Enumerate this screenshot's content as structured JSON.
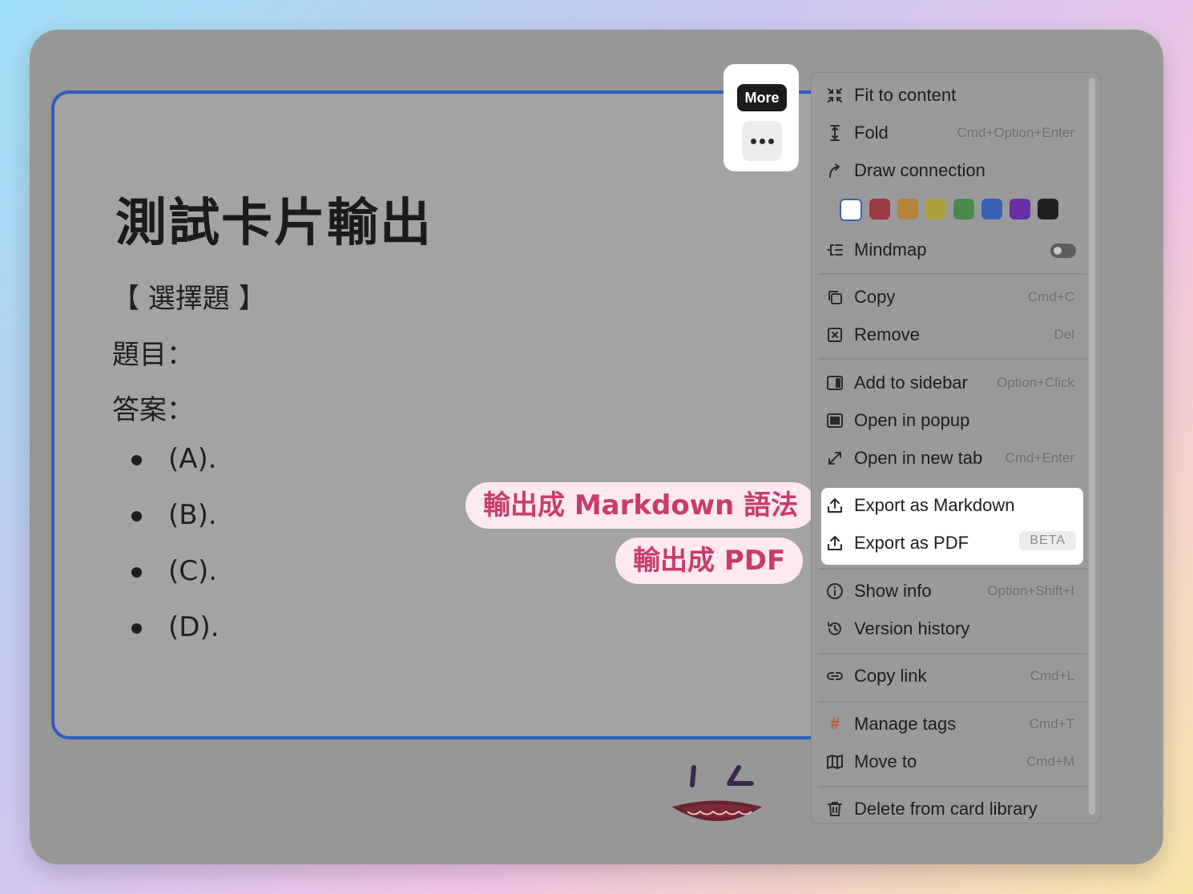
{
  "card": {
    "title": "測試卡片輸出",
    "section": "【 選擇題 】",
    "question_label": "題目：",
    "answer_label": "答案：",
    "options": [
      "(A).",
      "(B).",
      "(C).",
      "(D)."
    ]
  },
  "more": {
    "tooltip": "More"
  },
  "callouts": {
    "markdown": "輸出成 Markdown 語法",
    "pdf": "輸出成 PDF"
  },
  "menu": {
    "fit": {
      "label": "Fit to content",
      "icon": "fit-icon"
    },
    "fold": {
      "label": "Fold",
      "shortcut": "Cmd+Option+Enter",
      "icon": "fold-icon"
    },
    "draw": {
      "label": "Draw connection",
      "icon": "connection-arrow-icon"
    },
    "colors": [
      "none",
      "#9a3a42",
      "#b5823a",
      "#a9a23a",
      "#4a8a4d",
      "#3a62b5",
      "#6a2ea6",
      "#202020"
    ],
    "mindmap": {
      "label": "Mindmap",
      "enabled": false,
      "icon": "mindmap-icon"
    },
    "copy": {
      "label": "Copy",
      "shortcut": "Cmd+C",
      "icon": "copy-icon"
    },
    "remove": {
      "label": "Remove",
      "shortcut": "Del",
      "icon": "remove-icon"
    },
    "sidebar": {
      "label": "Add to sidebar",
      "shortcut": "Option+Click",
      "icon": "sidebar-icon"
    },
    "popup": {
      "label": "Open in popup",
      "icon": "popup-icon"
    },
    "newtab": {
      "label": "Open in new tab",
      "shortcut": "Cmd+Enter",
      "icon": "expand-icon"
    },
    "export_md": {
      "label": "Export as Markdown",
      "icon": "export-icon"
    },
    "export_pdf": {
      "label": "Export as PDF",
      "badge": "BETA",
      "icon": "export-icon"
    },
    "info": {
      "label": "Show info",
      "shortcut": "Option+Shift+I",
      "icon": "info-icon"
    },
    "history": {
      "label": "Version history",
      "icon": "history-icon"
    },
    "link": {
      "label": "Copy link",
      "shortcut": "Cmd+L",
      "icon": "link-icon"
    },
    "tags": {
      "label": "Manage tags",
      "shortcut": "Cmd+T",
      "icon": "hash-icon"
    },
    "move": {
      "label": "Move to",
      "shortcut": "Cmd+M",
      "icon": "map-icon"
    },
    "delete": {
      "label": "Delete from card library",
      "icon": "trash-icon"
    }
  },
  "colors": {
    "card_border": "#2f5bbd",
    "callout_text": "#c93b6e",
    "callout_bg": "#fde9ee",
    "tag_icon": "#c0552a"
  }
}
